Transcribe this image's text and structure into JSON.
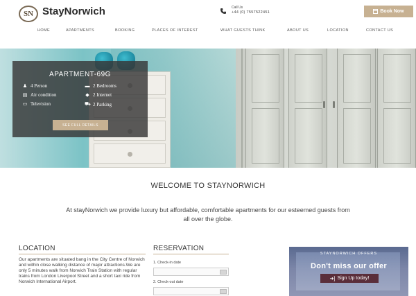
{
  "brand": {
    "logo_mark": "SN",
    "name": "StayNorwich"
  },
  "contact": {
    "label": "Call Us",
    "phone": "+44 (0) 7557522451"
  },
  "book_now": {
    "label": "Book Now",
    "icon": "calendar-icon"
  },
  "nav": [
    {
      "label": "HOME"
    },
    {
      "label": "APARTMENTS"
    },
    {
      "label": "BOOKING"
    },
    {
      "label": "PLACES OF INTEREST"
    },
    {
      "label": "WHAT GUESTS THINK"
    },
    {
      "label": "ABOUT US"
    },
    {
      "label": "LOCATION"
    },
    {
      "label": "CONTACT US"
    }
  ],
  "apartment": {
    "title": "APARTMENT-69G",
    "features": [
      {
        "icon": "person-icon",
        "label": "4 Person"
      },
      {
        "icon": "bed-icon",
        "label": "2 Bedrooms"
      },
      {
        "icon": "air-condition-icon",
        "label": "Air condition"
      },
      {
        "icon": "wifi-icon",
        "label": "2 Internet"
      },
      {
        "icon": "tv-icon",
        "label": "Television"
      },
      {
        "icon": "car-icon",
        "label": "2 Parking"
      }
    ],
    "details_button": "SEE FULL DETAILS"
  },
  "welcome": {
    "title": "WELCOME TO STAYNORWICH",
    "text": "At stayNorwich we provide luxury but affordable, comfortable apartments for our esteemed guests from all over the globe."
  },
  "location": {
    "title": "LOCATION",
    "text": "Our apartments are situated bang in the City Centre of Norwich and within close walking distance of major attractions.We are only 5 minutes walk from Norwich Train Station with regular trains from London Liverpool Street and a short taxi ride from Norwich International Airport."
  },
  "reservation": {
    "title": "RESERVATION",
    "checkin_label": "1. Check-in date",
    "checkout_label": "2. Check-out date"
  },
  "promo": {
    "small": "STAYNORWICH OFFERS",
    "headline": "Don't miss our offer",
    "button": "Sign Up today!"
  },
  "colors": {
    "accent": "#c7b192",
    "overlay": "#373737",
    "promo_button": "#5a2e3a"
  }
}
